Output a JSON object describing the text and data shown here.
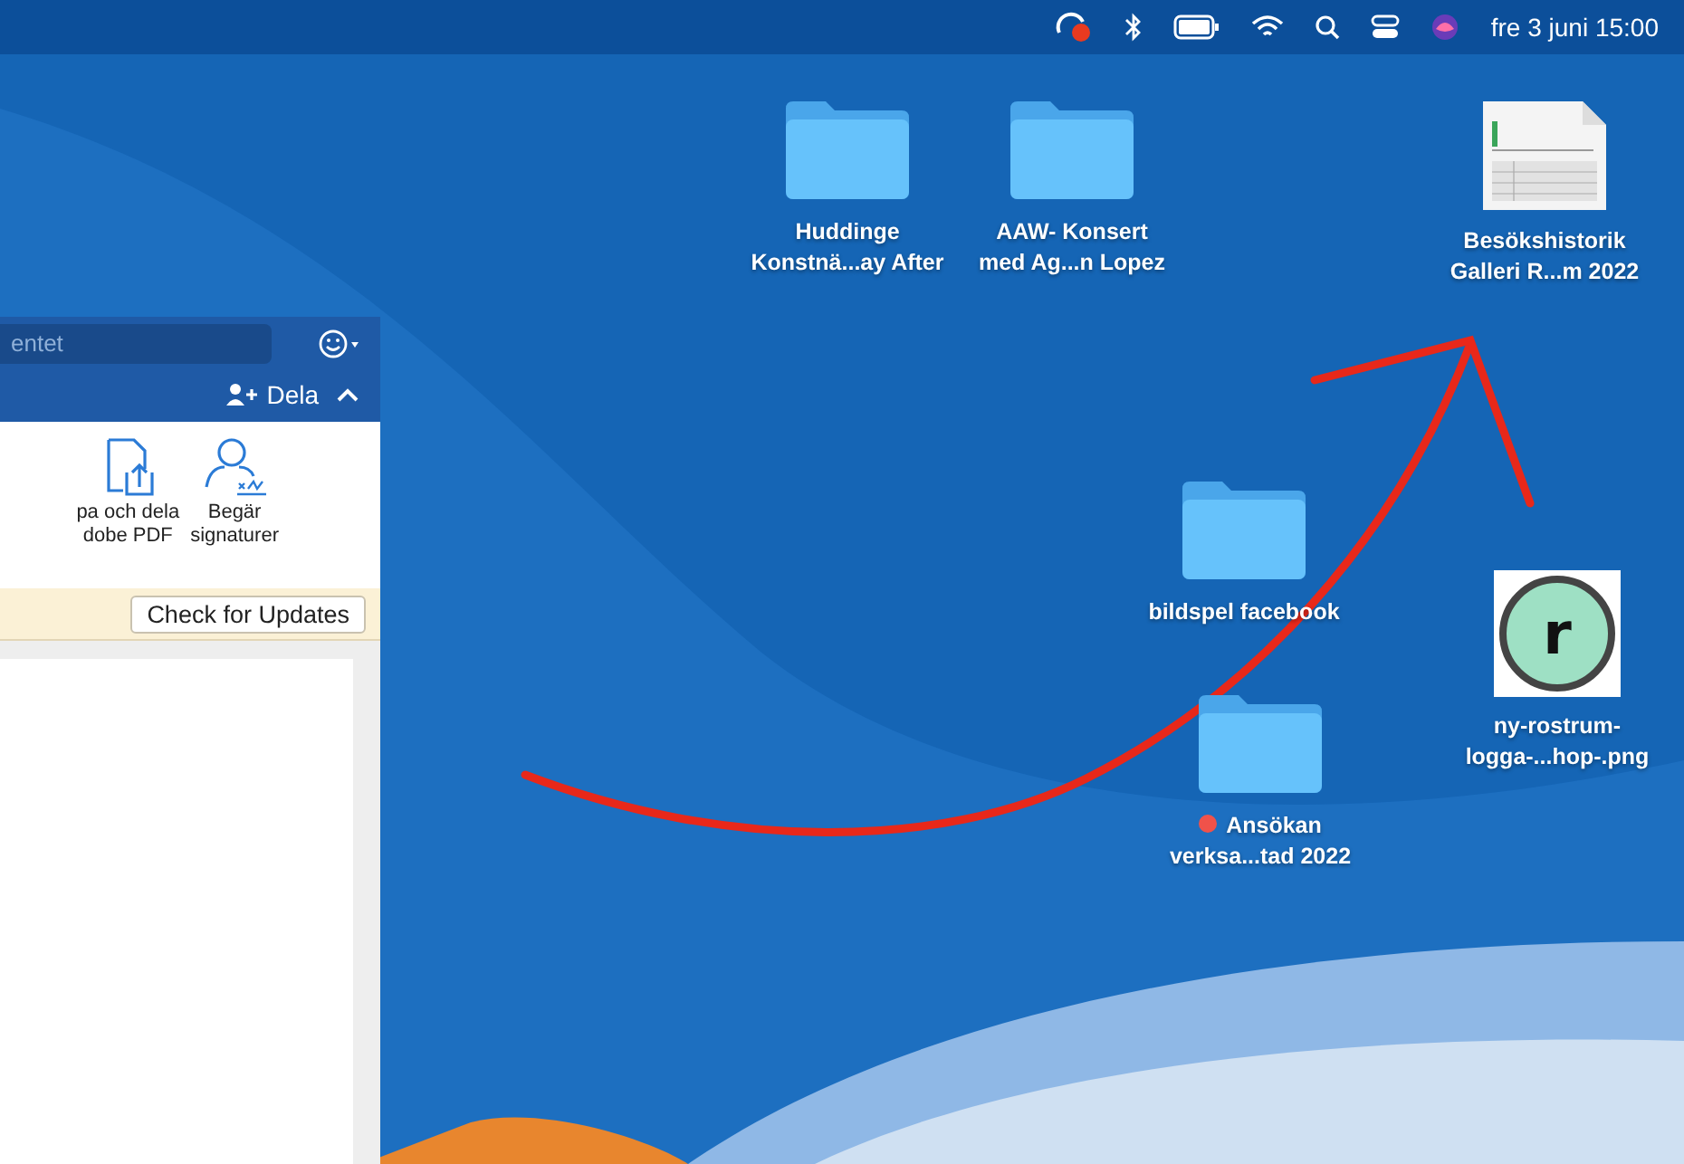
{
  "menu_bar": {
    "clock": "fre 3 juni 15:00"
  },
  "window": {
    "search": {
      "value": "entet"
    },
    "share_button": "Dela",
    "ribbon_buttons": [
      {
        "kind": "pdf",
        "label": "pa och dela\ndobe PDF"
      },
      {
        "kind": "signature",
        "label": "Begär\nsignaturer"
      }
    ],
    "update_button": "Check for Updates"
  },
  "desktop_icons": [
    {
      "kind": "folder",
      "label": "Huddinge\nKonstnä...ay After"
    },
    {
      "kind": "folder",
      "label": "AAW- Konsert\nmed Ag...n Lopez"
    },
    {
      "kind": "document",
      "label": "Besökshistorik\nGalleri R...m 2022"
    },
    {
      "kind": "folder",
      "label": "bildspel facebook"
    },
    {
      "kind": "image",
      "label": "ny-rostrum-\nlogga-...hop-.png",
      "logo_letter": "r"
    },
    {
      "kind": "folder",
      "label": "Ansökan\nverksa...tad 2022",
      "color": "#f0524a"
    }
  ]
}
